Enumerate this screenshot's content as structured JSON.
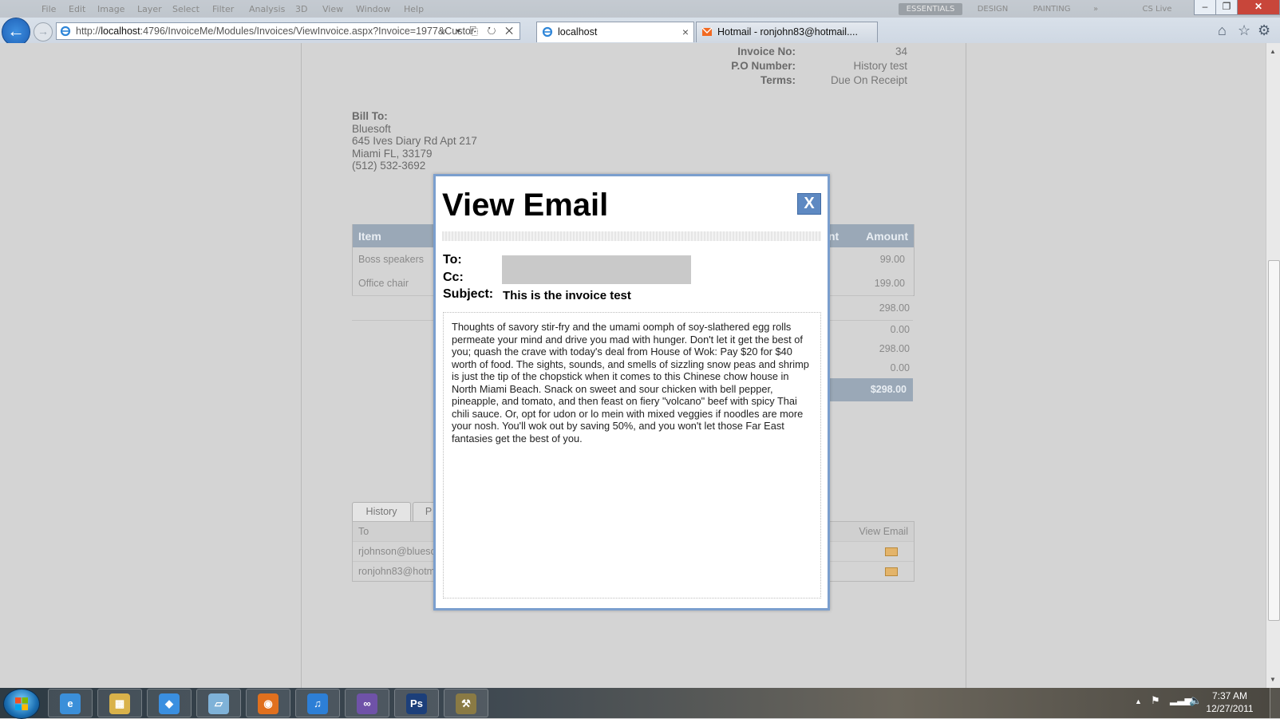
{
  "browser": {
    "menu_ghost": [
      "File",
      "Edit",
      "Image",
      "Layer",
      "Select",
      "Filter",
      "Analysis",
      "3D",
      "View",
      "Window",
      "Help"
    ],
    "ghost_buttons": [
      "ESSENTIALS",
      "DESIGN",
      "PAINTING",
      "»",
      "CS Live"
    ],
    "address_url_host": "localhost",
    "address_url_prefix": "http://",
    "address_url_rest": ":4796/InvoiceMe/Modules/Invoices/ViewInvoice.aspx?Invoice=1977&Custor",
    "address_tools": "⌕ ▾ ⎘ ↻ ✕",
    "tabs": [
      {
        "label": "localhost",
        "active": true
      },
      {
        "label": "Hotmail - ronjohn83@hotmail....",
        "active": false
      }
    ],
    "window_controls": {
      "minimize": "–",
      "restore": "❐",
      "close": "✕"
    }
  },
  "invoice": {
    "meta": [
      {
        "label": "Invoice No:",
        "value": "34"
      },
      {
        "label": "P.O Number:",
        "value": "History test"
      },
      {
        "label": "Terms:",
        "value": "Due On Receipt"
      }
    ],
    "bill_to": {
      "heading": "Bill To:",
      "lines": [
        "Bluesoft",
        "645 Ives Diary Rd Apt 217",
        "Miami FL, 33179",
        "(512) 532-3692"
      ]
    },
    "table": {
      "col_item": "Item",
      "col_amount_partial": "nt",
      "col_amount": "Amount",
      "rows": [
        {
          "item": "Boss speakers",
          "amount": "99.00"
        },
        {
          "item": "Office chair",
          "amount": "199.00"
        }
      ],
      "subtotal": "298.00",
      "totals": [
        "0.00",
        "298.00",
        "0.00"
      ],
      "grand_total": "$298.00"
    },
    "history": {
      "tabs": [
        "History",
        "P"
      ],
      "col_to": "To",
      "col_view": "View Email",
      "rows": [
        {
          "to": "rjohnson@blueso"
        },
        {
          "to": "ronjohn83@hotm"
        }
      ]
    }
  },
  "modal": {
    "title": "View Email",
    "close_label": "X",
    "to_label": "To:",
    "cc_label": "Cc:",
    "subject_label": "Subject:",
    "subject_value": "This is the invoice test",
    "body": "Thoughts of savory stir-fry and the umami oomph of soy-slathered egg rolls permeate your mind and drive you mad with hunger. Don't let it get the best of you; quash the crave with today's deal from House of Wok: Pay $20 for $40 worth of food. The sights, sounds, and smells of sizzling snow peas and shrimp is just the tip of the chopstick when it comes to this Chinese chow house in North Miami Beach. Snack on sweet and sour chicken with bell pepper, pineapple, and tomato, and then feast on fiery \"volcano\" beef with spicy Thai chili sauce. Or, opt for udon or lo mein with mixed veggies if noodles are more your nosh. You'll wok out by saving 50%, and you won't let those Far East fantasies get the best of you."
  },
  "taskbar": {
    "apps": [
      {
        "name": "internet-explorer",
        "glyph": "e",
        "color": "#3b8fd9"
      },
      {
        "name": "file-explorer",
        "glyph": "▦",
        "color": "#d9b24a"
      },
      {
        "name": "dropbox",
        "glyph": "◆",
        "color": "#3a8fe0"
      },
      {
        "name": "notes",
        "glyph": "▱",
        "color": "#7fb2d8"
      },
      {
        "name": "firefox",
        "glyph": "◉",
        "color": "#e0701e"
      },
      {
        "name": "itunes",
        "glyph": "♫",
        "color": "#2d7fd6"
      },
      {
        "name": "visual-studio",
        "glyph": "∞",
        "color": "#6f52a8"
      },
      {
        "name": "photoshop",
        "glyph": "Ps",
        "color": "#1c3f7a"
      },
      {
        "name": "tools",
        "glyph": "⚒",
        "color": "#8a7a44"
      }
    ],
    "clock_time": "7:37 AM",
    "clock_date": "12/27/2011"
  },
  "colors": {
    "modal_border": "#7b9fce",
    "close_button": "#5e89c2",
    "table_header": "#9aa8b7"
  }
}
